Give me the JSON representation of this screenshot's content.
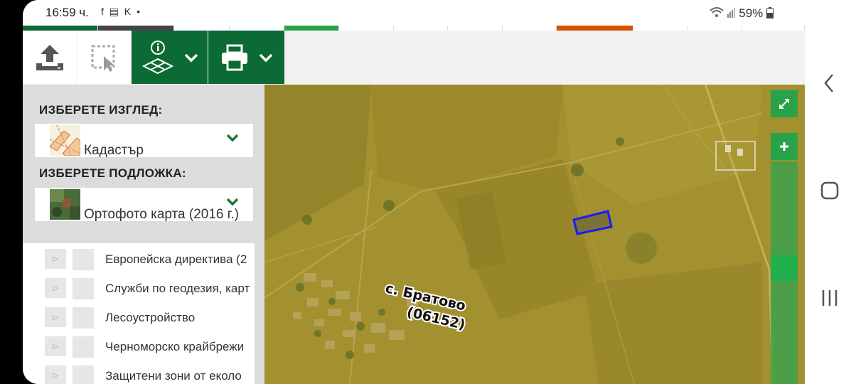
{
  "status": {
    "time": "16:59 ч.",
    "notif_icons": "f ▤ K •",
    "battery": "59%"
  },
  "sidebar": {
    "view_title": "ИЗБЕРЕТЕ ИЗГЛЕД:",
    "view_value": "Кадастър",
    "base_title": "ИЗБЕРЕТЕ ПОДЛОЖКА:",
    "base_value": "Ортофото карта (2016 г.)",
    "layers": [
      {
        "label": "Европейска директива (2"
      },
      {
        "label": "Служби по геодезия, карт"
      },
      {
        "label": "Лесоустройство"
      },
      {
        "label": "Черноморско крайбрежи"
      },
      {
        "label": "Защитени зони от еколо"
      }
    ]
  },
  "map": {
    "village_name": "с. Братово",
    "village_code": "(06152)"
  },
  "colors": {
    "brand_green": "#0c6a34",
    "control_green": "#28a34a",
    "parcel_outline": "#1a1aff",
    "tab_accent_orange": "#d35400"
  },
  "icons": [
    "upload-icon",
    "select-area-icon",
    "layers-info-icon",
    "chevron-down-icon",
    "print-icon",
    "back-icon",
    "home-icon",
    "recents-icon"
  ]
}
